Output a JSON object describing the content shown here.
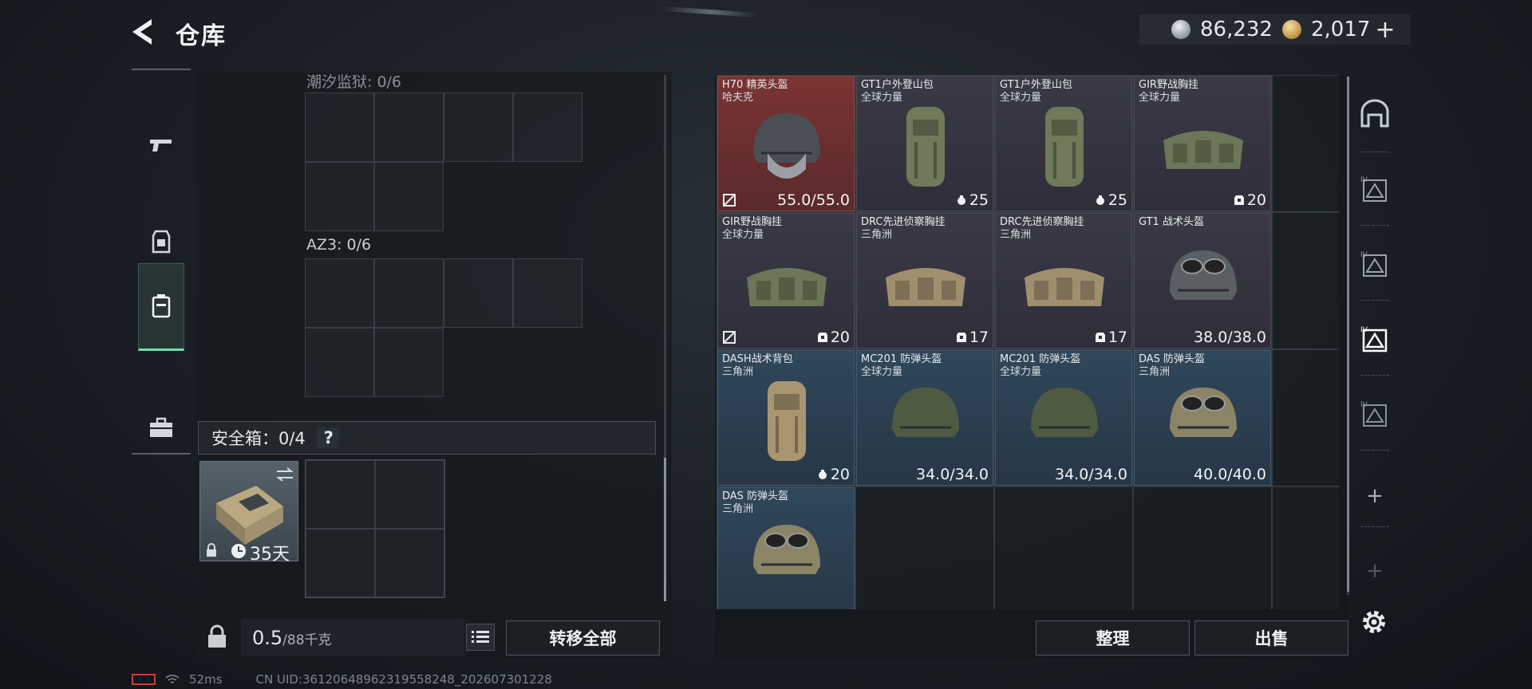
{
  "header": {
    "title": "仓库"
  },
  "currency": {
    "silver": "86,232",
    "gold": "2,017",
    "add": "+"
  },
  "sidebar": {
    "tabs": [
      "weapons",
      "gear",
      "containers",
      "case"
    ]
  },
  "left": {
    "slot1_label": "潮汐监狱: 0/6",
    "slot2_label": "AZ3: 0/6",
    "safe_label": "安全箱：0/4",
    "help": "?",
    "safe_days": "35天",
    "weight_value": "0.5",
    "weight_cap": "/88千克",
    "transfer_label": "转移全部"
  },
  "items": [
    {
      "name": "H70 精英头盔",
      "maker": "哈夫克",
      "value": "55.0/55.0",
      "tier": "red"
    },
    {
      "name": "GT1户外登山包",
      "maker": "全球力量",
      "value": "25",
      "tier": "purple"
    },
    {
      "name": "GT1户外登山包",
      "maker": "全球力量",
      "value": "25",
      "tier": "purple"
    },
    {
      "name": "GIR野战胸挂",
      "maker": "全球力量",
      "value": "20",
      "tier": "purple"
    },
    {
      "name": "GIR野战胸挂",
      "maker": "全球力量",
      "value": "20",
      "tier": "purple"
    },
    {
      "name": "DRC先进侦察胸挂",
      "maker": "三角洲",
      "value": "17",
      "tier": "purple"
    },
    {
      "name": "DRC先进侦察胸挂",
      "maker": "三角洲",
      "value": "17",
      "tier": "purple"
    },
    {
      "name": "GT1 战术头盔",
      "maker": "",
      "value": "38.0/38.0",
      "tier": "purple"
    },
    {
      "name": "DASH战术背包",
      "maker": "三角洲",
      "value": "20",
      "tier": "blue"
    },
    {
      "name": "MC201 防弹头盔",
      "maker": "全球力量",
      "value": "34.0/34.0",
      "tier": "blue"
    },
    {
      "name": "MC201 防弹头盔",
      "maker": "全球力量",
      "value": "34.0/34.0",
      "tier": "blue"
    },
    {
      "name": "DAS 防弹头盔",
      "maker": "三角洲",
      "value": "40.0/40.0",
      "tier": "blue"
    },
    {
      "name": "DAS 防弹头盔",
      "maker": "三角洲",
      "value": "",
      "tier": "blue"
    }
  ],
  "right": {
    "sort_label": "整理",
    "sell_label": "出售"
  },
  "status": {
    "ping": "52ms",
    "uid": "CN UID:3612064896231955824​8_202607301228"
  },
  "colors": {
    "accent_green": "#6fe0a9",
    "tier_red": "#7a3433",
    "tier_purple": "#3a3946",
    "tier_blue": "#30475a"
  }
}
